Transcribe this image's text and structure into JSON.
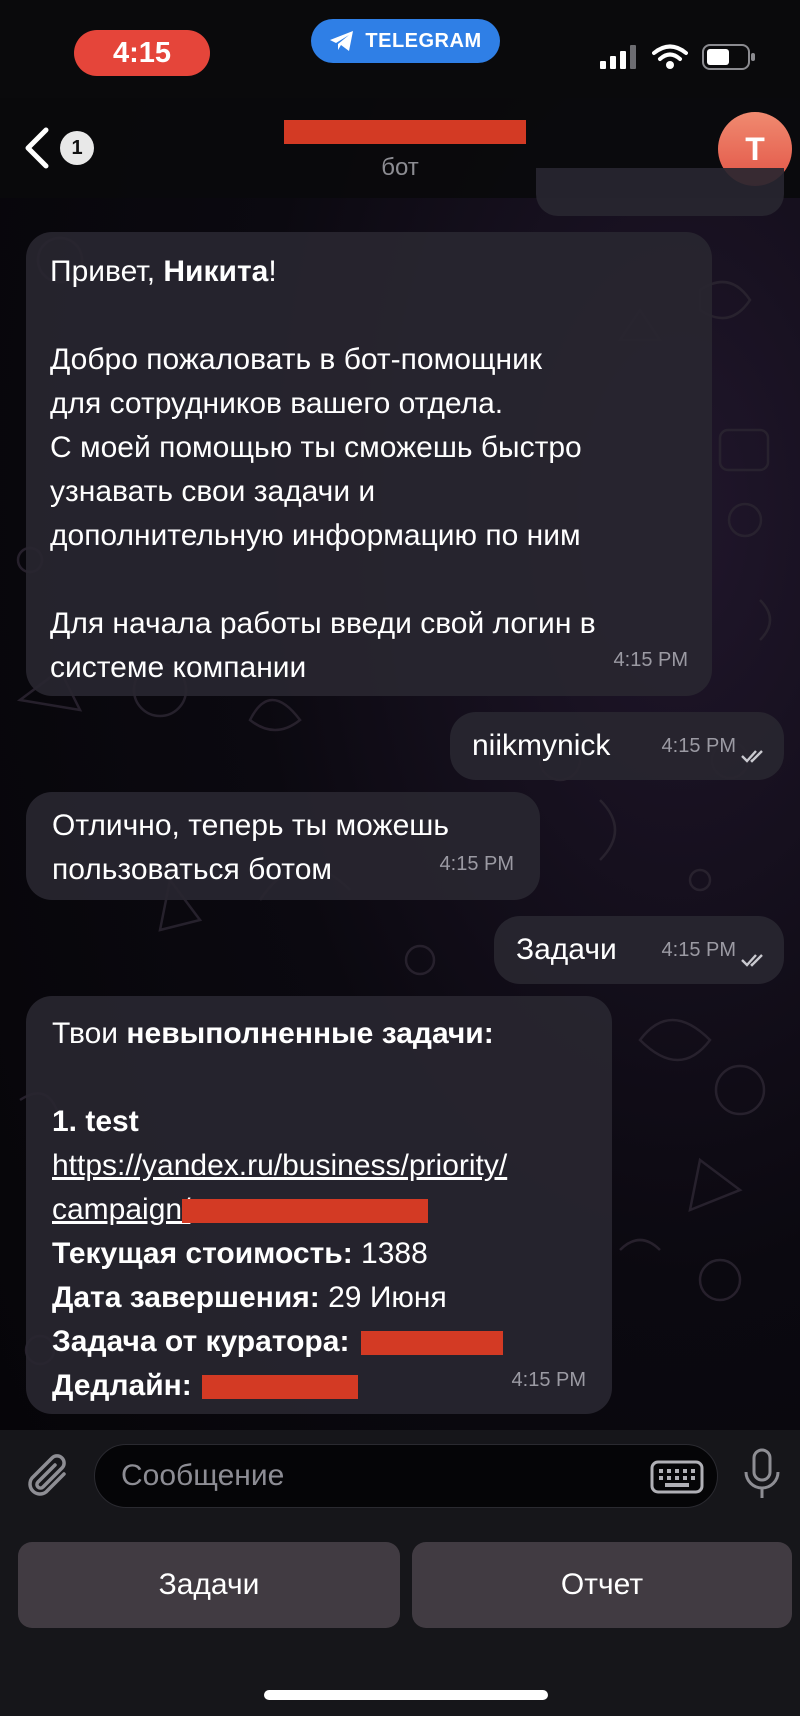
{
  "status_bar": {
    "time": "4:15",
    "app_label": "TELEGRAM"
  },
  "header": {
    "back_count": "1",
    "subtitle": "бот",
    "avatar_letter": "T"
  },
  "messages": [
    {
      "greeting_prefix": "Привет, ",
      "greeting_name": "Никита",
      "greeting_suffix": "!",
      "body": "Добро пожаловать в бот-помощник\nдля сотрудников вашего отдела.\nС моей помощью ты сможешь быстро\nузнавать свои задачи и\nдополнительную информацию по ним",
      "footer": "Для начала работы введи свой логин в\nсистеме компании",
      "time": "4:15 PM"
    },
    {
      "text": "niikmynick",
      "time": "4:15 PM"
    },
    {
      "text": "Отлично, теперь ты можешь\nпользоваться ботом",
      "time": "4:15 PM"
    },
    {
      "text": "Задачи",
      "time": "4:15 PM"
    },
    {
      "intro_prefix": "Твои ",
      "intro_bold": "невыполненные задачи:",
      "task_title": "1. test",
      "link_line1": "https://yandex.ru/business/priority/",
      "link_line2": "campaign/",
      "cost_label": "Текущая стоимость:",
      "cost_value": " 1388",
      "end_label": "Дата завершения:",
      "end_value": " 29 Июня",
      "curator_label": "Задача от куратора:",
      "deadline_label": "Дедлайн:",
      "time": "4:15 PM"
    }
  ],
  "composer": {
    "placeholder": "Сообщение"
  },
  "keyboard": {
    "buttons": [
      "Задачи",
      "Отчет"
    ]
  },
  "colors": {
    "accent_red": "#e5453a",
    "telegram_blue": "#2f7fe6",
    "redaction": "#d33a24"
  }
}
